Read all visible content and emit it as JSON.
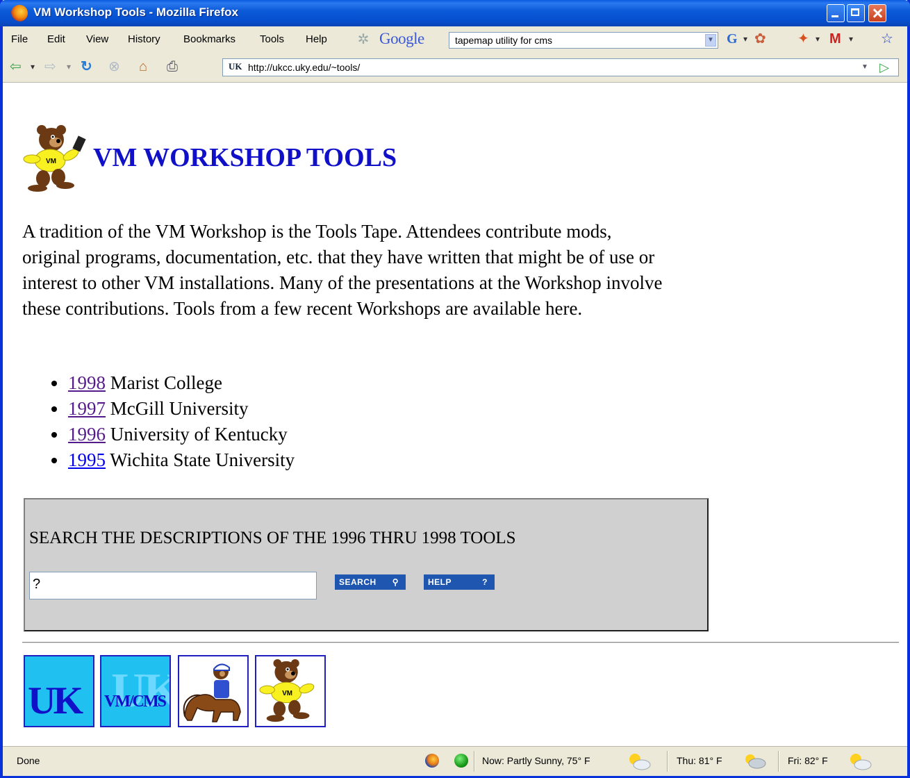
{
  "window": {
    "title": "VM Workshop Tools - Mozilla Firefox"
  },
  "menu": {
    "items": [
      "File",
      "Edit",
      "View",
      "History",
      "Bookmarks",
      "Tools",
      "Help"
    ],
    "google_label": "Google",
    "google_search_value": "tapemap utility for cms"
  },
  "nav": {
    "url": "http://ukcc.uky.edu/~tools/",
    "site_badge": "UK"
  },
  "page": {
    "heading": "VM WORKSHOP TOOLS",
    "intro": "A tradition of the VM Workshop is the Tools Tape. Attendees contribute mods, original programs, documentation, etc. that they have written that might be of use or interest to other VM installations. Many of the presentations at the Workshop involve these contributions. Tools from a few recent Workshops are available here.",
    "years": [
      {
        "year": "1998",
        "location": "Marist College"
      },
      {
        "year": "1997",
        "location": "McGill University"
      },
      {
        "year": "1996",
        "location": "University of Kentucky"
      },
      {
        "year": "1995",
        "location": "Wichita State University"
      }
    ],
    "search": {
      "heading": "SEARCH THE DESCRIPTIONS OF THE 1996 THRU 1998 TOOLS",
      "input_value": "?",
      "search_button": "SEARCH",
      "help_button": "HELP",
      "help_glyph": "?"
    },
    "footer_icons": {
      "uk": "UK",
      "vm_bg": "UK",
      "vm": "VM/CMS"
    }
  },
  "status": {
    "text": "Done",
    "now": "Now: Partly Sunny, 75° F",
    "thu": "Thu: 81° F",
    "fri": "Fri: 82° F"
  }
}
